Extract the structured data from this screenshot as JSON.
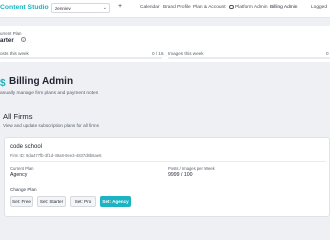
{
  "app": {
    "brand": "Content Studio"
  },
  "header": {
    "firm_select_value": "zenniev",
    "nav": [
      "Calendar",
      "Brand Profile",
      "Plan & Account",
      "Platform Admin",
      "Billing Admin",
      "Logged"
    ]
  },
  "usage": {
    "plan_label": "urrent Plan",
    "plan_value": "arter",
    "posts_label": "osts this week",
    "posts_count": "0 / 16",
    "posts_used": 0,
    "images_label": "Images this week",
    "images_count": "0",
    "images_used": 0
  },
  "page": {
    "title": "Billing Admin",
    "subtitle": "anually manage firm plans and payment notes"
  },
  "firms_section": {
    "title": "All Firms",
    "subtitle": "View and update subscription plans for all firms"
  },
  "firm_card": {
    "name": "code school",
    "firm_id": "Firm ID: 9da477fb-3f1d-49a8-9ee3-4837d8b6ae6",
    "current_plan_label": "Current Plan",
    "current_plan_value": "Agency",
    "posts_images_label": "Posts / Images per Week",
    "posts_images_value": "9999 / 100",
    "change_plan_label": "Change Plan",
    "buttons": [
      "Set: Free",
      "Set: Starter",
      "Set: Pro",
      "Set: Agency"
    ]
  },
  "colors": {
    "accent": "#1cb3c2",
    "background": "#eef0f3"
  }
}
